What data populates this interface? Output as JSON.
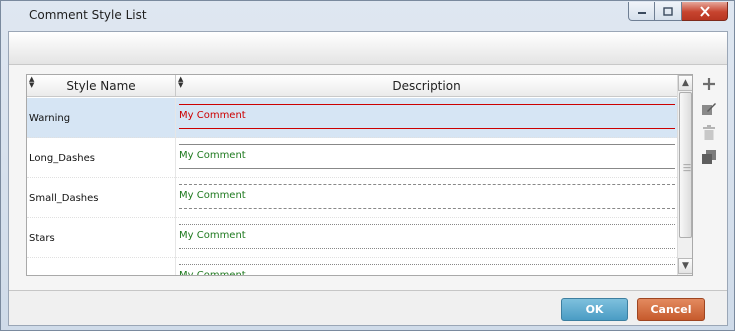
{
  "window": {
    "title": "Comment Style List"
  },
  "grid": {
    "columns": [
      "Style Name",
      "Description"
    ],
    "rows": [
      {
        "name": "Warning",
        "description": "My Comment",
        "text_color": "#cc0000",
        "line_color": "#cc0000",
        "line_style": "solid",
        "selected": true
      },
      {
        "name": "Long_Dashes",
        "description": "My Comment",
        "text_color": "#1f7a1f",
        "line_color": "#888888",
        "line_style": "solid",
        "selected": false
      },
      {
        "name": "Small_Dashes",
        "description": "My Comment",
        "text_color": "#1f7a1f",
        "line_color": "#888888",
        "line_style": "dashed",
        "selected": false
      },
      {
        "name": "Stars",
        "description": "My Comment",
        "text_color": "#1f7a1f",
        "line_color": "#888888",
        "line_style": "dotted",
        "selected": false
      },
      {
        "name": "",
        "description": "My Comment",
        "text_color": "#1f7a1f",
        "line_color": "#888888",
        "line_style": "dotted",
        "selected": false
      }
    ]
  },
  "tools": [
    {
      "name": "add-icon",
      "glyph": "+"
    },
    {
      "name": "edit-icon",
      "glyph": "✎"
    },
    {
      "name": "delete-icon",
      "glyph": "🗑"
    },
    {
      "name": "copy-icon",
      "glyph": "❐"
    }
  ],
  "buttons": {
    "ok": "OK",
    "cancel": "Cancel"
  },
  "colors": {
    "selected_row": "#d6e5f4",
    "ok_button": "#4a9cc4",
    "cancel_button": "#c65a2c"
  }
}
